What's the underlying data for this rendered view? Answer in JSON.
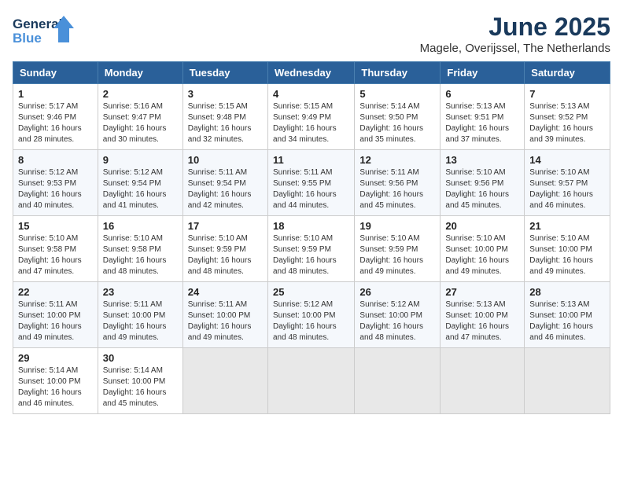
{
  "logo": {
    "line1": "General",
    "line2": "Blue"
  },
  "title": "June 2025",
  "location": "Magele, Overijssel, The Netherlands",
  "weekdays": [
    "Sunday",
    "Monday",
    "Tuesday",
    "Wednesday",
    "Thursday",
    "Friday",
    "Saturday"
  ],
  "weeks": [
    [
      {
        "day": 1,
        "info": "Sunrise: 5:17 AM\nSunset: 9:46 PM\nDaylight: 16 hours\nand 28 minutes."
      },
      {
        "day": 2,
        "info": "Sunrise: 5:16 AM\nSunset: 9:47 PM\nDaylight: 16 hours\nand 30 minutes."
      },
      {
        "day": 3,
        "info": "Sunrise: 5:15 AM\nSunset: 9:48 PM\nDaylight: 16 hours\nand 32 minutes."
      },
      {
        "day": 4,
        "info": "Sunrise: 5:15 AM\nSunset: 9:49 PM\nDaylight: 16 hours\nand 34 minutes."
      },
      {
        "day": 5,
        "info": "Sunrise: 5:14 AM\nSunset: 9:50 PM\nDaylight: 16 hours\nand 35 minutes."
      },
      {
        "day": 6,
        "info": "Sunrise: 5:13 AM\nSunset: 9:51 PM\nDaylight: 16 hours\nand 37 minutes."
      },
      {
        "day": 7,
        "info": "Sunrise: 5:13 AM\nSunset: 9:52 PM\nDaylight: 16 hours\nand 39 minutes."
      }
    ],
    [
      {
        "day": 8,
        "info": "Sunrise: 5:12 AM\nSunset: 9:53 PM\nDaylight: 16 hours\nand 40 minutes."
      },
      {
        "day": 9,
        "info": "Sunrise: 5:12 AM\nSunset: 9:54 PM\nDaylight: 16 hours\nand 41 minutes."
      },
      {
        "day": 10,
        "info": "Sunrise: 5:11 AM\nSunset: 9:54 PM\nDaylight: 16 hours\nand 42 minutes."
      },
      {
        "day": 11,
        "info": "Sunrise: 5:11 AM\nSunset: 9:55 PM\nDaylight: 16 hours\nand 44 minutes."
      },
      {
        "day": 12,
        "info": "Sunrise: 5:11 AM\nSunset: 9:56 PM\nDaylight: 16 hours\nand 45 minutes."
      },
      {
        "day": 13,
        "info": "Sunrise: 5:10 AM\nSunset: 9:56 PM\nDaylight: 16 hours\nand 45 minutes."
      },
      {
        "day": 14,
        "info": "Sunrise: 5:10 AM\nSunset: 9:57 PM\nDaylight: 16 hours\nand 46 minutes."
      }
    ],
    [
      {
        "day": 15,
        "info": "Sunrise: 5:10 AM\nSunset: 9:58 PM\nDaylight: 16 hours\nand 47 minutes."
      },
      {
        "day": 16,
        "info": "Sunrise: 5:10 AM\nSunset: 9:58 PM\nDaylight: 16 hours\nand 48 minutes."
      },
      {
        "day": 17,
        "info": "Sunrise: 5:10 AM\nSunset: 9:59 PM\nDaylight: 16 hours\nand 48 minutes."
      },
      {
        "day": 18,
        "info": "Sunrise: 5:10 AM\nSunset: 9:59 PM\nDaylight: 16 hours\nand 48 minutes."
      },
      {
        "day": 19,
        "info": "Sunrise: 5:10 AM\nSunset: 9:59 PM\nDaylight: 16 hours\nand 49 minutes."
      },
      {
        "day": 20,
        "info": "Sunrise: 5:10 AM\nSunset: 10:00 PM\nDaylight: 16 hours\nand 49 minutes."
      },
      {
        "day": 21,
        "info": "Sunrise: 5:10 AM\nSunset: 10:00 PM\nDaylight: 16 hours\nand 49 minutes."
      }
    ],
    [
      {
        "day": 22,
        "info": "Sunrise: 5:11 AM\nSunset: 10:00 PM\nDaylight: 16 hours\nand 49 minutes."
      },
      {
        "day": 23,
        "info": "Sunrise: 5:11 AM\nSunset: 10:00 PM\nDaylight: 16 hours\nand 49 minutes."
      },
      {
        "day": 24,
        "info": "Sunrise: 5:11 AM\nSunset: 10:00 PM\nDaylight: 16 hours\nand 49 minutes."
      },
      {
        "day": 25,
        "info": "Sunrise: 5:12 AM\nSunset: 10:00 PM\nDaylight: 16 hours\nand 48 minutes."
      },
      {
        "day": 26,
        "info": "Sunrise: 5:12 AM\nSunset: 10:00 PM\nDaylight: 16 hours\nand 48 minutes."
      },
      {
        "day": 27,
        "info": "Sunrise: 5:13 AM\nSunset: 10:00 PM\nDaylight: 16 hours\nand 47 minutes."
      },
      {
        "day": 28,
        "info": "Sunrise: 5:13 AM\nSunset: 10:00 PM\nDaylight: 16 hours\nand 46 minutes."
      }
    ],
    [
      {
        "day": 29,
        "info": "Sunrise: 5:14 AM\nSunset: 10:00 PM\nDaylight: 16 hours\nand 46 minutes."
      },
      {
        "day": 30,
        "info": "Sunrise: 5:14 AM\nSunset: 10:00 PM\nDaylight: 16 hours\nand 45 minutes."
      },
      null,
      null,
      null,
      null,
      null
    ]
  ]
}
